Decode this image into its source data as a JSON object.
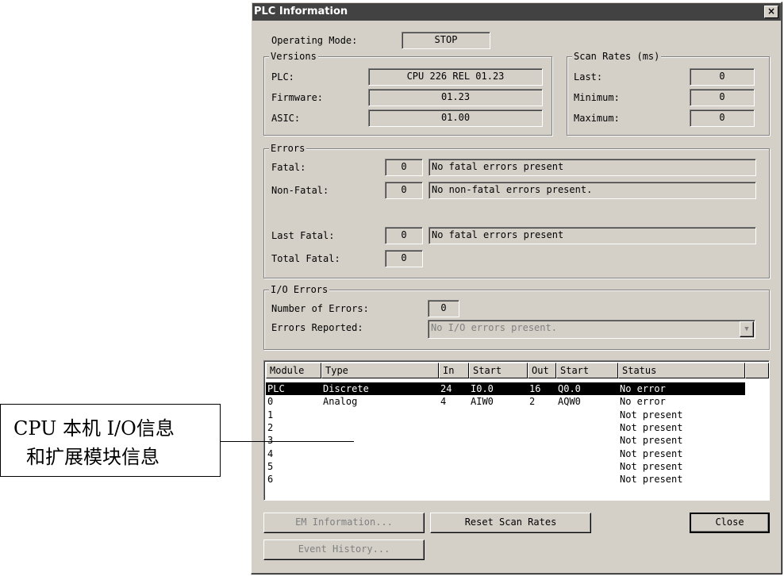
{
  "window": {
    "title": "PLC Information",
    "close_glyph": "×"
  },
  "operating_mode": {
    "label": "Operating Mode:",
    "value": "STOP"
  },
  "versions": {
    "legend": "Versions",
    "plc_label": "PLC:",
    "plc_value": "CPU 226 REL 01.23",
    "firmware_label": "Firmware:",
    "firmware_value": "01.23",
    "asic_label": "ASIC:",
    "asic_value": "01.00"
  },
  "scan_rates": {
    "legend": "Scan Rates (ms)",
    "last_label": "Last:",
    "last_value": "0",
    "minimum_label": "Minimum:",
    "minimum_value": "0",
    "maximum_label": "Maximum:",
    "maximum_value": "0"
  },
  "errors": {
    "legend": "Errors",
    "fatal_label": "Fatal:",
    "fatal_count": "0",
    "fatal_text": "No fatal errors present",
    "nonfatal_label": "Non-Fatal:",
    "nonfatal_count": "0",
    "nonfatal_text": "No non-fatal errors present.",
    "lastfatal_label": "Last Fatal:",
    "lastfatal_count": "0",
    "lastfatal_text": "No fatal errors present",
    "totalfatal_label": "Total Fatal:",
    "totalfatal_count": "0"
  },
  "io_errors": {
    "legend": "I/O Errors",
    "number_label": "Number of Errors:",
    "number_value": "0",
    "reported_label": "Errors Reported:",
    "reported_value": "No I/O errors present."
  },
  "module_table": {
    "headers": [
      "Module",
      "Type",
      "In",
      "Start",
      "Out",
      "Start",
      "Status"
    ],
    "rows": [
      [
        "PLC",
        "Discrete",
        "24",
        "I0.0",
        "16",
        "Q0.0",
        "No error"
      ],
      [
        "0",
        "Analog",
        "4",
        "AIW0",
        "2",
        "AQW0",
        "No error"
      ],
      [
        "1",
        "",
        "",
        "",
        "",
        "",
        "Not present"
      ],
      [
        "2",
        "",
        "",
        "",
        "",
        "",
        "Not present"
      ],
      [
        "3",
        "",
        "",
        "",
        "",
        "",
        "Not present"
      ],
      [
        "4",
        "",
        "",
        "",
        "",
        "",
        "Not present"
      ],
      [
        "5",
        "",
        "",
        "",
        "",
        "",
        "Not present"
      ],
      [
        "6",
        "",
        "",
        "",
        "",
        "",
        "Not present"
      ]
    ]
  },
  "buttons": {
    "em_information": "EM Information...",
    "reset_scan_rates": "Reset Scan Rates",
    "close": "Close",
    "event_history": "Event History..."
  },
  "annotation": {
    "line1": "CPU 本机 I/O信息",
    "line2": "和扩展模块信息"
  }
}
